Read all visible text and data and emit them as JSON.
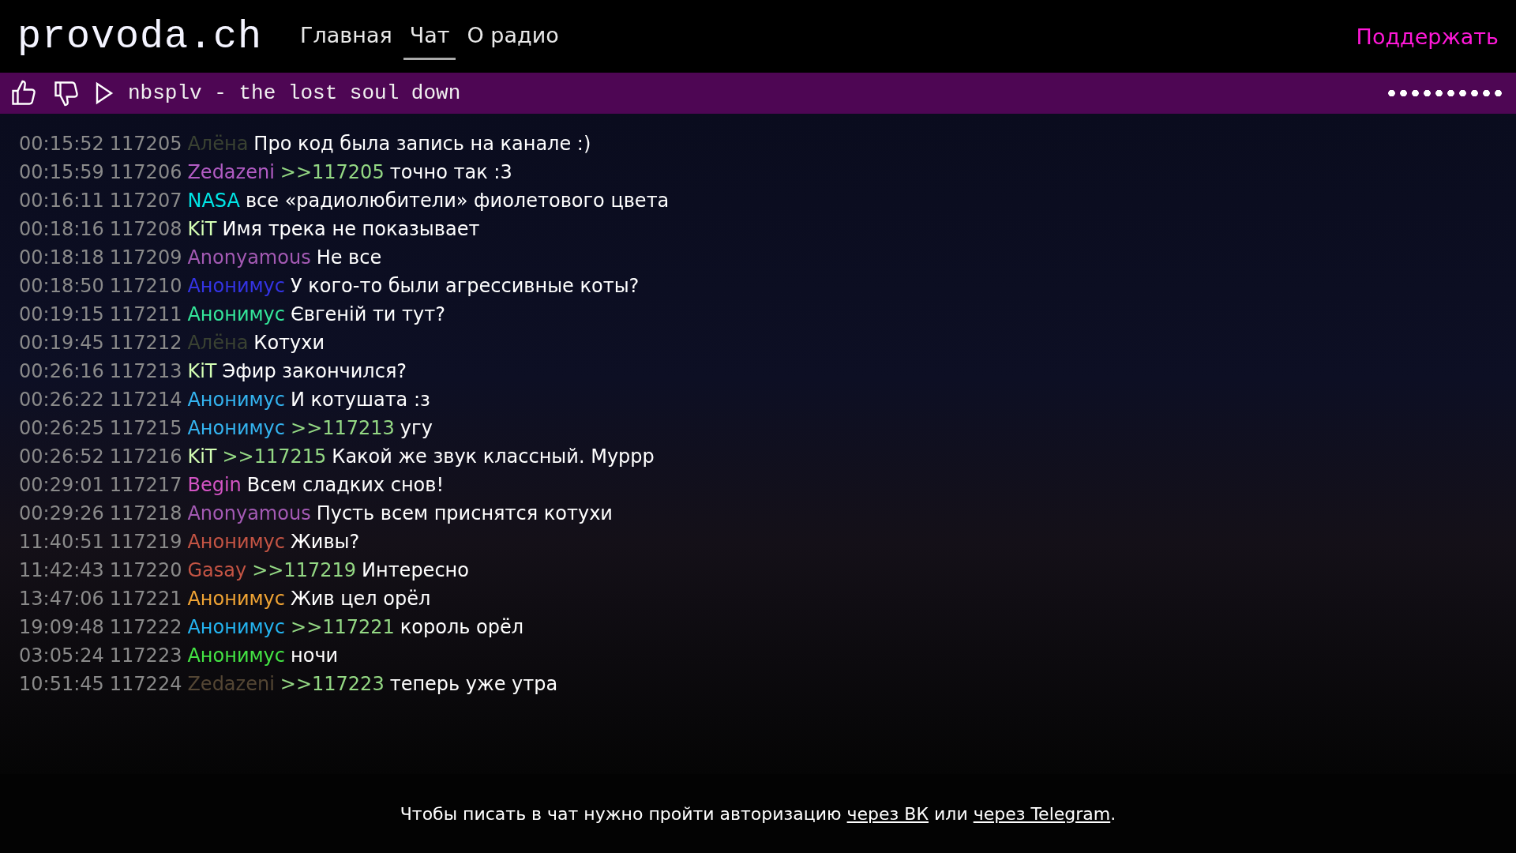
{
  "header": {
    "logo": "provoda.ch",
    "nav": [
      {
        "label": "Главная",
        "selected": false
      },
      {
        "label": "Чат",
        "selected": true
      },
      {
        "label": "О радио",
        "selected": false
      }
    ],
    "support": "Поддержать"
  },
  "player": {
    "track": "nbsplv - the lost soul down",
    "volume": {
      "level": 1
    }
  },
  "messages": [
    {
      "time": "00:15:52",
      "id": "117205",
      "author": "Алёна",
      "color": "#3a4232",
      "text": "Про код была запись на канале :)"
    },
    {
      "time": "00:15:59",
      "id": "117206",
      "author": "Zedazeni",
      "color": "#b25cc4",
      "reply": ">>117205",
      "text": "точно так :3"
    },
    {
      "time": "00:16:11",
      "id": "117207",
      "author": "NASA",
      "color": "#00e6e6",
      "text": "все «радиолюбители» фиолетового цвета"
    },
    {
      "time": "00:18:16",
      "id": "117208",
      "author": "KiT",
      "color": "#d4ffb4",
      "text": "Имя трека не показывает"
    },
    {
      "time": "00:18:18",
      "id": "117209",
      "author": "Anonyamous",
      "color": "#a45ab4",
      "text": "Не все"
    },
    {
      "time": "00:18:50",
      "id": "117210",
      "author": "Анонимус",
      "color": "#3434e6",
      "text": "У кого-то были агрессивные коты?"
    },
    {
      "time": "00:19:15",
      "id": "117211",
      "author": "Анонимус",
      "color": "#34e69a",
      "text": "Євгеній ти тут?"
    },
    {
      "time": "00:19:45",
      "id": "117212",
      "author": "Алёна",
      "color": "#3a4232",
      "text": "Котухи"
    },
    {
      "time": "00:26:16",
      "id": "117213",
      "author": "KiT",
      "color": "#d4ffb4",
      "text": "Эфир закончился?"
    },
    {
      "time": "00:26:22",
      "id": "117214",
      "author": "Анонимус",
      "color": "#34b4f0",
      "text": "И котушата :з"
    },
    {
      "time": "00:26:25",
      "id": "117215",
      "author": "Анонимус",
      "color": "#34b4f0",
      "reply": ">>117213",
      "text": "угу"
    },
    {
      "time": "00:26:52",
      "id": "117216",
      "author": "KiT",
      "color": "#d4ffb4",
      "reply": ">>117215",
      "text": "Какой же звук классный. Муррр"
    },
    {
      "time": "00:29:01",
      "id": "117217",
      "author": "Begin",
      "color": "#d454c4",
      "text": "Всем сладких снов!"
    },
    {
      "time": "00:29:26",
      "id": "117218",
      "author": "Anonyamous",
      "color": "#a45ab4",
      "text": "Пусть всем приснятся котухи"
    },
    {
      "time": "11:40:51",
      "id": "117219",
      "author": "Анонимус",
      "color": "#c45444",
      "text": "Живы?"
    },
    {
      "time": "11:42:43",
      "id": "117220",
      "author": "Gasay",
      "color": "#c45444",
      "reply": ">>117219",
      "text": "Интересно"
    },
    {
      "time": "13:47:06",
      "id": "117221",
      "author": "Анонимус",
      "color": "#f0a434",
      "text": "Жив цел орёл"
    },
    {
      "time": "19:09:48",
      "id": "117222",
      "author": "Анонимус",
      "color": "#24b4f0",
      "reply": ">>117221",
      "text": "король орёл"
    },
    {
      "time": "03:05:24",
      "id": "117223",
      "author": "Анонимус",
      "color": "#44e444",
      "text": "ночи"
    },
    {
      "time": "10:51:45",
      "id": "117224",
      "author": "Zedazeni",
      "color": "#544634",
      "reply": ">>117223",
      "text": "теперь уже утра"
    }
  ],
  "footer": {
    "text_before": "Чтобы писать в чат нужно пройти авторизацию",
    "link_vk": "через ВК",
    "text_middle": "или",
    "link_telegram": "через Telegram",
    "text_after": "."
  }
}
